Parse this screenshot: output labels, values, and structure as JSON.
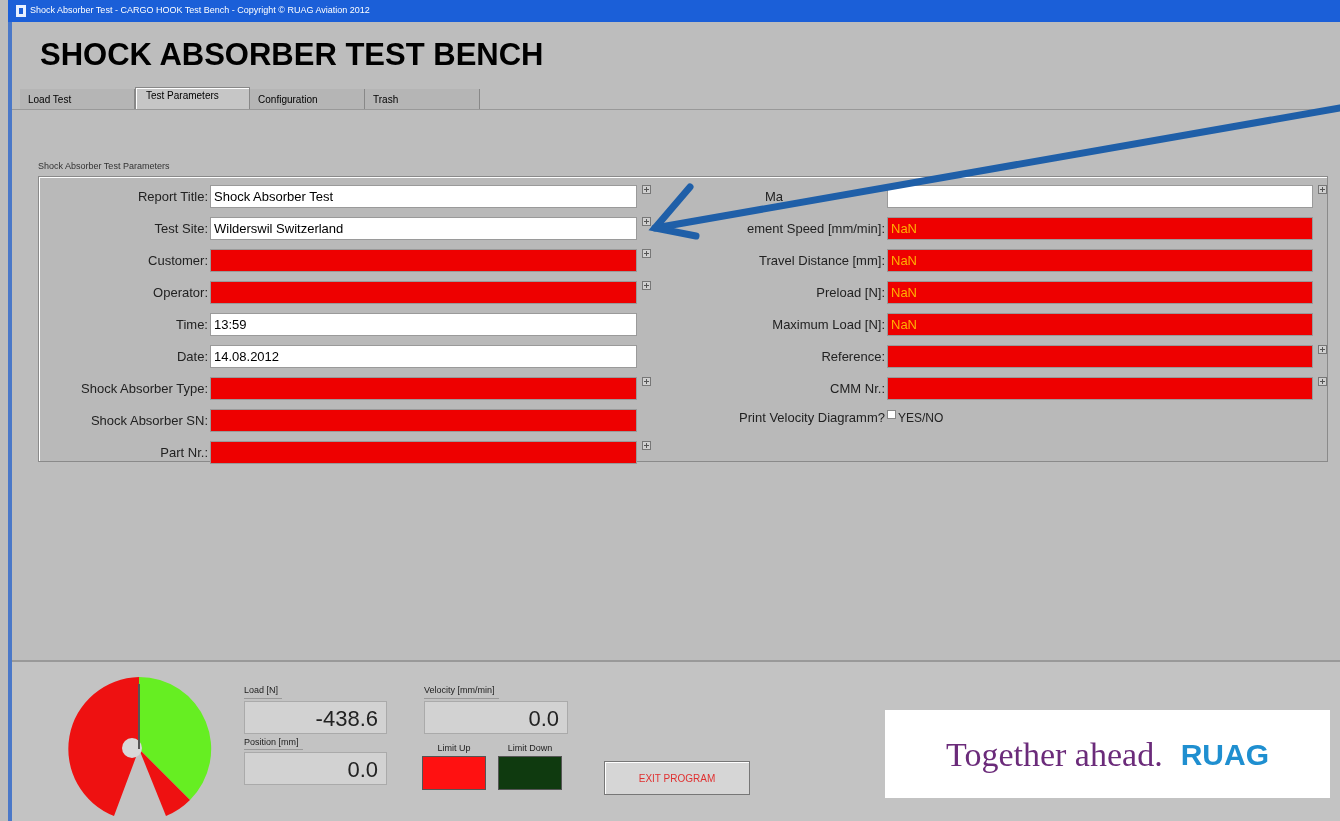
{
  "window": {
    "title": "Shock Absorber Test - CARGO HOOK Test Bench - Copyright © RUAG Aviation 2012"
  },
  "heading": "SHOCK ABSORBER TEST BENCH",
  "tabs": [
    {
      "label": "Load Test",
      "selected": false
    },
    {
      "label": "Test Parameters",
      "selected": true
    },
    {
      "label": "Configuration",
      "selected": false
    },
    {
      "label": "Trash",
      "selected": false
    }
  ],
  "parameters": {
    "title": "Shock Absorber Test Parameters",
    "left_fields": [
      {
        "label": "Report Title:",
        "value": "Shock Absorber Test",
        "invalid": false,
        "browse": true
      },
      {
        "label": "Test Site:",
        "value": "Wilderswil Switzerland",
        "invalid": false,
        "browse": true
      },
      {
        "label": "Customer:",
        "invalid": true,
        "browse": true
      },
      {
        "label": "Operator:",
        "invalid": true,
        "browse": true
      },
      {
        "label": "Time:",
        "value": "13:59",
        "invalid": false,
        "browse": false
      },
      {
        "label": "Date:",
        "value": "14.08.2012",
        "invalid": false,
        "browse": false
      },
      {
        "label": "Shock Absorber Type:",
        "invalid": true,
        "browse": true
      },
      {
        "label": "Shock Absorber SN:",
        "invalid": true,
        "browse": false
      },
      {
        "label": "Part Nr.:",
        "invalid": true,
        "browse": true
      }
    ],
    "right_fields": [
      {
        "label": "Ma",
        "invalid": false,
        "browse": true
      },
      {
        "label": "ement Speed [mm/min]:",
        "value": "NaN",
        "invalid": true,
        "browse": false
      },
      {
        "label": "Travel Distance [mm]:",
        "value": "NaN",
        "invalid": true,
        "browse": false
      },
      {
        "label": "Preload [N]:",
        "value": "NaN",
        "invalid": true,
        "browse": false
      },
      {
        "label": "Maximum Load [N]:",
        "value": "NaN",
        "invalid": true,
        "browse": false
      },
      {
        "label": "Reference:",
        "invalid": true,
        "browse": true
      },
      {
        "label": "CMM Nr.:",
        "invalid": true,
        "browse": true
      }
    ],
    "print_velocity": {
      "label": "Print Velocity Diagramm?",
      "checked": false,
      "option": "YES/NO"
    }
  },
  "indicators": [
    {
      "label": "Load [N]",
      "value": "-438.6"
    },
    {
      "label": "Position [mm]",
      "value": "0.0"
    },
    {
      "label": "Velocity [mm/min]",
      "value": "0.0"
    }
  ],
  "limits": [
    {
      "label": "Limit Up",
      "on": true
    },
    {
      "label": "Limit Down",
      "on": false
    }
  ],
  "exit_button": "EXIT PROGRAM",
  "logo": {
    "slogan": "Together ahead.",
    "brand": "RUAG"
  }
}
